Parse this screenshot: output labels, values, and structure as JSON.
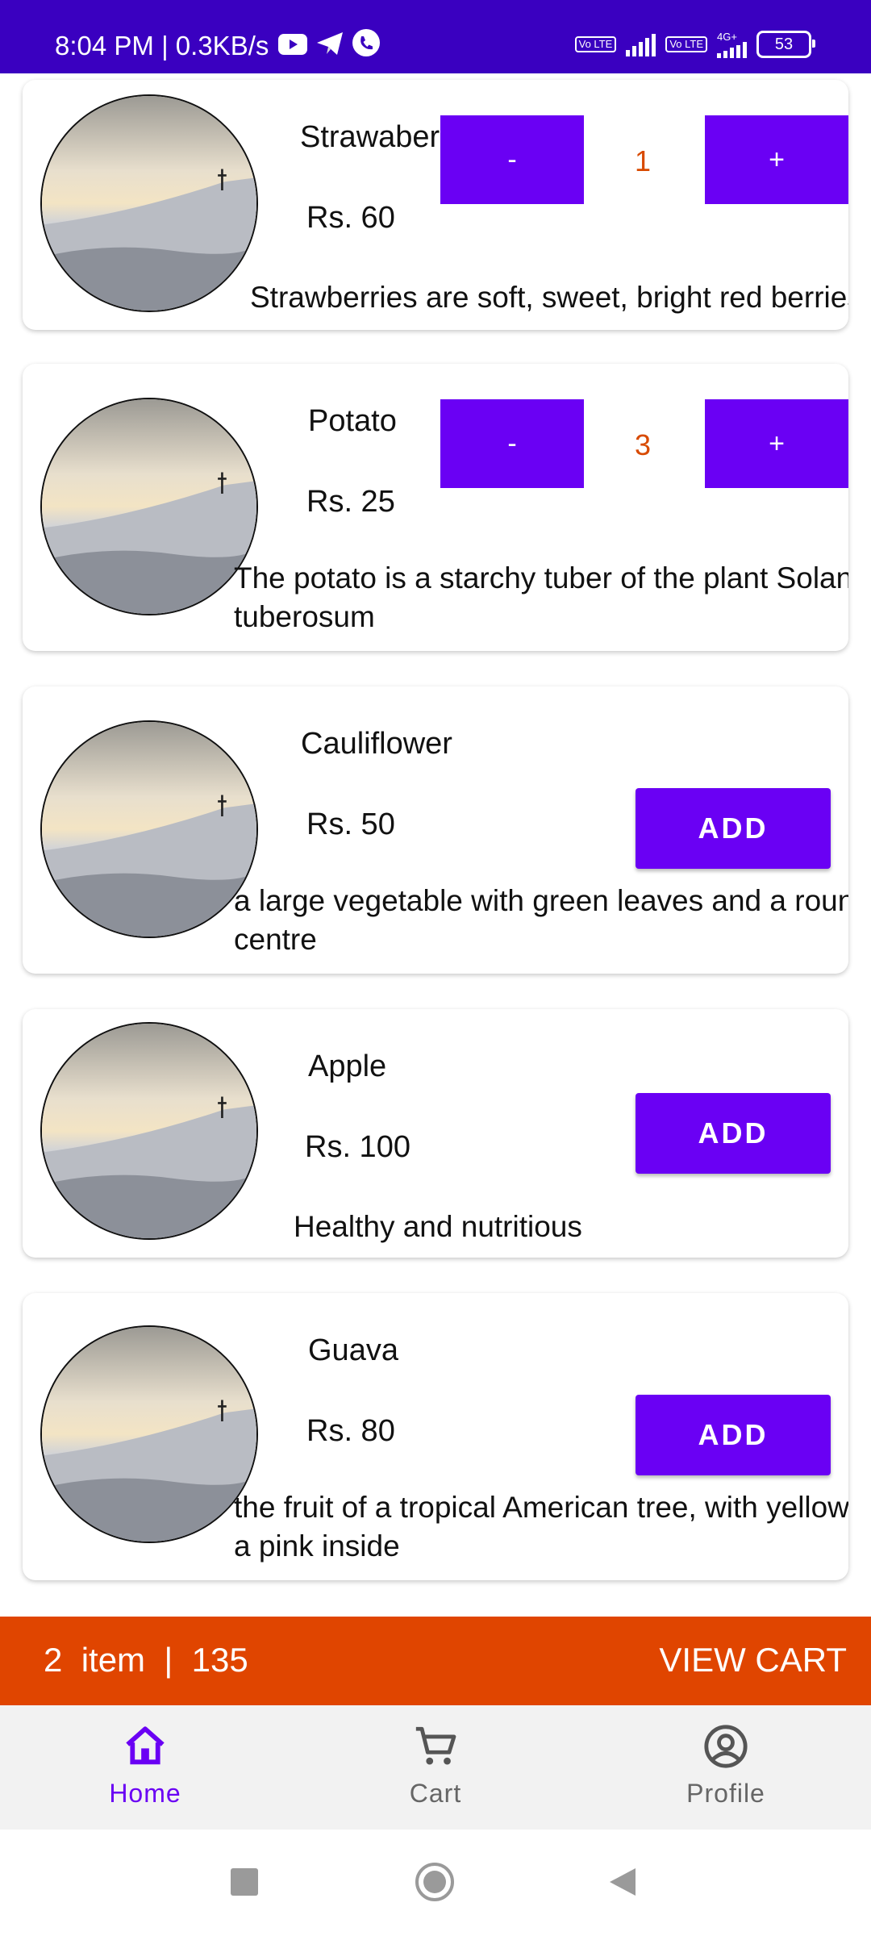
{
  "status_bar": {
    "time_speed": "8:04 PM | 0.3KB/s",
    "sim1": "Vo LTE",
    "sim2": "Vo LTE",
    "network": "4G+",
    "battery": "53"
  },
  "products": [
    {
      "name": "Strawaberry",
      "price": "Rs. 60",
      "description": "Strawberries are soft, sweet, bright red berries",
      "quantity": "1",
      "minus_label": "-",
      "plus_label": "+"
    },
    {
      "name": "Potato",
      "price": "Rs. 25",
      "description": "The potato is a starchy tuber of the plant Solanum\ntuberosum",
      "quantity": "3",
      "minus_label": "-",
      "plus_label": "+"
    },
    {
      "name": "Cauliflower",
      "price": "Rs. 50",
      "description": "a large vegetable with green leaves and a round white\ncentre",
      "add_label": "ADD"
    },
    {
      "name": "Apple",
      "price": "Rs. 100",
      "description": "Healthy and nutritious",
      "add_label": "ADD"
    },
    {
      "name": "Guava",
      "price": "Rs. 80",
      "description": "the fruit of a tropical American tree, with yellow skin and\na pink inside",
      "add_label": "ADD"
    }
  ],
  "cart_bar": {
    "summary": "2  item  |  135",
    "view_cart": "VIEW CART"
  },
  "bottom_nav": {
    "items": [
      {
        "label": "Home",
        "icon": "home-icon",
        "active": true
      },
      {
        "label": "Cart",
        "icon": "cart-icon",
        "active": false
      },
      {
        "label": "Profile",
        "icon": "profile-icon",
        "active": false
      }
    ]
  },
  "colors": {
    "status_bar": "#3A00C0",
    "primary": "#6A00F4",
    "cart_bar": "#E04500",
    "quantity_text": "#D84A00",
    "nav_active": "#6A00F4",
    "nav_inactive": "#666666"
  }
}
